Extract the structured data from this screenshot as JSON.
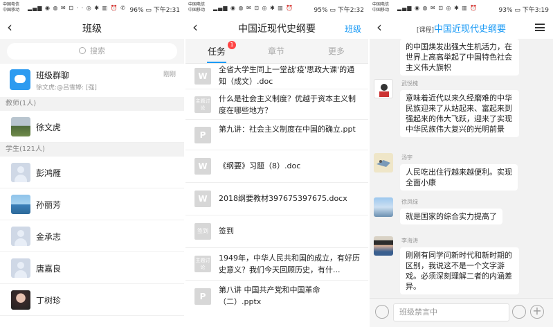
{
  "status": [
    {
      "carrier1": "中国电信",
      "carrier2": "中国移动",
      "battery": "96%",
      "time": "下午2:31"
    },
    {
      "carrier1": "中国电信",
      "carrier2": "中国移动",
      "battery": "95%",
      "time": "下午2:32"
    },
    {
      "carrier1": "中国电信",
      "carrier2": "中国移动",
      "battery": "93%",
      "time": "下午3:19"
    }
  ],
  "panel1": {
    "title": "班级",
    "search_placeholder": "搜索",
    "group_chat": {
      "name": "班级群聊",
      "preview": "徐文虎:@吕雪婷: [强]",
      "time": "刚刚"
    },
    "teacher_header": "教师(1人)",
    "teachers": [
      {
        "name": "徐文虎"
      }
    ],
    "student_header": "学生(121人)",
    "students": [
      {
        "name": "彭鸿雁"
      },
      {
        "name": "孙丽芳"
      },
      {
        "name": "金承志"
      },
      {
        "name": "唐嘉良"
      },
      {
        "name": "丁树珍"
      }
    ]
  },
  "panel2": {
    "title": "中国近现代史纲要",
    "right_link": "班级",
    "tabs": [
      {
        "label": "任务"
      },
      {
        "label": "章节"
      },
      {
        "label": "更多"
      }
    ],
    "task_badge": "1",
    "topic_icon_label": "主题讨论",
    "sign_icon_label": "签到",
    "tasks": [
      {
        "type": "doc",
        "text": "全省大学生同上一堂战'疫'思政大课'的通知（成文）.doc"
      },
      {
        "type": "topic",
        "text": "什么是社会主义制度？优越于资本主义制度在哪些地方？"
      },
      {
        "type": "ppt",
        "text": "第九讲：社会主义制度在中国的确立.ppt"
      },
      {
        "type": "doc",
        "text": "《纲要》习题（8）.doc"
      },
      {
        "type": "doc",
        "text": "2018纲要教材397675397675.docx"
      },
      {
        "type": "sign",
        "text": "签到"
      },
      {
        "type": "topic",
        "text": "1949年，中华人民共和国的成立，有好历史意义？我们今天回顾历史，有什..."
      },
      {
        "type": "ppt",
        "text": "第八讲  中国共产党和中国革命（二）.pptx"
      }
    ]
  },
  "panel3": {
    "title_tag": "[课程]",
    "title": "中国近现代史纲要",
    "messages": [
      {
        "name": "",
        "text": "的中国焕发出强大生机活力，在世界上高高举起了中国特色社会主义伟大旗帜"
      },
      {
        "name": "武悦槐",
        "text": "意味着近代以来久经磨难的中华民族迎来了从站起来、富起来到强起来的伟大飞跃，迎来了实现中华民族伟大复兴的光明前景"
      },
      {
        "name": "汤宇",
        "text": "人民吃出住行越来越便利。实现全面小康"
      },
      {
        "name": "徐凤绿",
        "text": "就是国家的综合实力提高了"
      },
      {
        "name": "李海涛",
        "text": "刚刚有同学问新时代和新时期的区别，我说这不是一个文字游戏。必须深刻理解二者的内涵差异。"
      }
    ],
    "input_placeholder": "班级禁言中"
  },
  "colors": {
    "accent": "#1a9af5",
    "badge": "#ff4444"
  }
}
